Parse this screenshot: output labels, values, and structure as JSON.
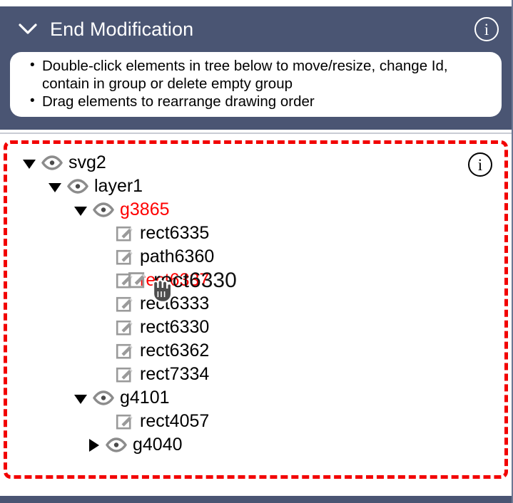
{
  "header": {
    "title": "End Modification",
    "collapse_icon": "chevron-down-icon",
    "info_icon": "info-icon",
    "info_label": "i",
    "background_color": "#4a5573",
    "text_color": "#ffffff"
  },
  "instructions": {
    "items": [
      "Double-click elements in tree below to move/resize, change Id, contain in group or delete empty group",
      "Drag elements to rearrange drawing order"
    ]
  },
  "tree": {
    "info_icon": "info-icon",
    "info_label": "i",
    "border_color": "#f20000",
    "selected_color": "#ff0000",
    "nodes": [
      {
        "label": "svg2",
        "depth": 0,
        "type": "group",
        "expanded": true,
        "icon": "eye-icon",
        "selected": false
      },
      {
        "label": "layer1",
        "depth": 1,
        "type": "group",
        "expanded": true,
        "icon": "eye-icon",
        "selected": false
      },
      {
        "label": "g3865",
        "depth": 2,
        "type": "group",
        "expanded": true,
        "icon": "eye-icon",
        "selected": true
      },
      {
        "label": "rect6335",
        "depth": 3,
        "type": "element",
        "expanded": null,
        "icon": "edit-icon",
        "selected": false
      },
      {
        "label": "path6360",
        "depth": 3,
        "type": "element",
        "expanded": null,
        "icon": "edit-icon",
        "selected": false
      },
      {
        "label": "rect6337",
        "depth": 3,
        "type": "element",
        "expanded": null,
        "icon": "edit-icon",
        "selected": true,
        "dragging": true
      },
      {
        "label": "rect6333",
        "depth": 3,
        "type": "element",
        "expanded": null,
        "icon": "edit-icon",
        "selected": false
      },
      {
        "label": "rect6330",
        "depth": 3,
        "type": "element",
        "expanded": null,
        "icon": "edit-icon",
        "selected": false
      },
      {
        "label": "rect6362",
        "depth": 3,
        "type": "element",
        "expanded": null,
        "icon": "edit-icon",
        "selected": false
      },
      {
        "label": "rect7334",
        "depth": 3,
        "type": "element",
        "expanded": null,
        "icon": "edit-icon",
        "selected": false
      },
      {
        "label": "g4101",
        "depth": 2,
        "type": "group",
        "expanded": true,
        "icon": "eye-icon",
        "selected": false
      },
      {
        "label": "rect4057",
        "depth": 3,
        "type": "element",
        "expanded": null,
        "icon": "edit-icon",
        "selected": false
      },
      {
        "label": "g4040",
        "depth": 2.5,
        "type": "group",
        "expanded": false,
        "icon": "eye-icon",
        "selected": false
      }
    ]
  },
  "drag": {
    "ghost_label": "rect6330",
    "ghost_icon": "edit-icon",
    "cursor_icon": "grabbing-hand-cursor"
  }
}
